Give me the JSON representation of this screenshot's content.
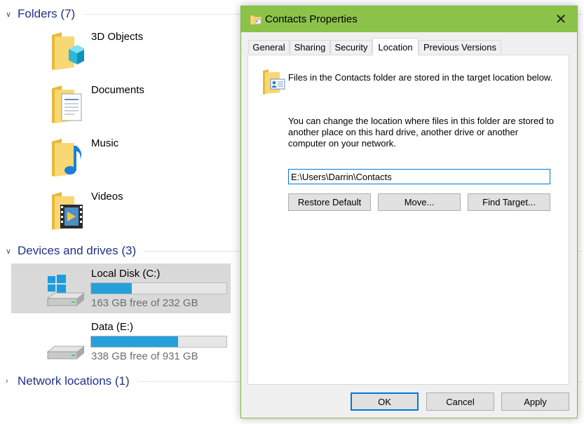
{
  "explorer": {
    "folders_header": "Folders (7)",
    "folders": [
      {
        "label": "3D Objects"
      },
      {
        "label": "Documents"
      },
      {
        "label": "Music"
      },
      {
        "label": "Videos"
      }
    ],
    "devices_header": "Devices and drives (3)",
    "drives": [
      {
        "name": "Local Disk (C:)",
        "free_text": "163 GB free of 232 GB",
        "used_fraction": 0.3
      },
      {
        "name": "Data (E:)",
        "free_text": "338 GB free of 931 GB",
        "used_fraction": 0.64
      }
    ],
    "network_header": "Network locations (1)"
  },
  "dialog": {
    "title": "Contacts Properties",
    "tabs": [
      {
        "label": "General"
      },
      {
        "label": "Sharing"
      },
      {
        "label": "Security"
      },
      {
        "label": "Location"
      },
      {
        "label": "Previous Versions"
      }
    ],
    "active_tab": "Location",
    "info_text": "Files in the Contacts folder are stored in the target location below.",
    "change_text": "You can change the location where files in this folder are stored to another place on this hard drive, another drive or another computer on your network.",
    "path_value": "E:\\Users\\Darrin\\Contacts",
    "restore_default_label": "Restore Default",
    "move_label": "Move...",
    "find_target_label": "Find Target...",
    "ok_label": "OK",
    "cancel_label": "Cancel",
    "apply_label": "Apply"
  },
  "colors": {
    "titlebar": "#8bc34a",
    "drive_fill": "#26a0da",
    "section_title": "#1e3287",
    "focus_border": "#0078d7"
  },
  "icons": [
    "folder-icon",
    "3d-objects-icon",
    "documents-icon",
    "music-icon",
    "videos-icon",
    "drive-icon",
    "windows-logo-icon",
    "contacts-folder-icon",
    "close-icon",
    "chevron-down-icon",
    "chevron-right-icon"
  ]
}
